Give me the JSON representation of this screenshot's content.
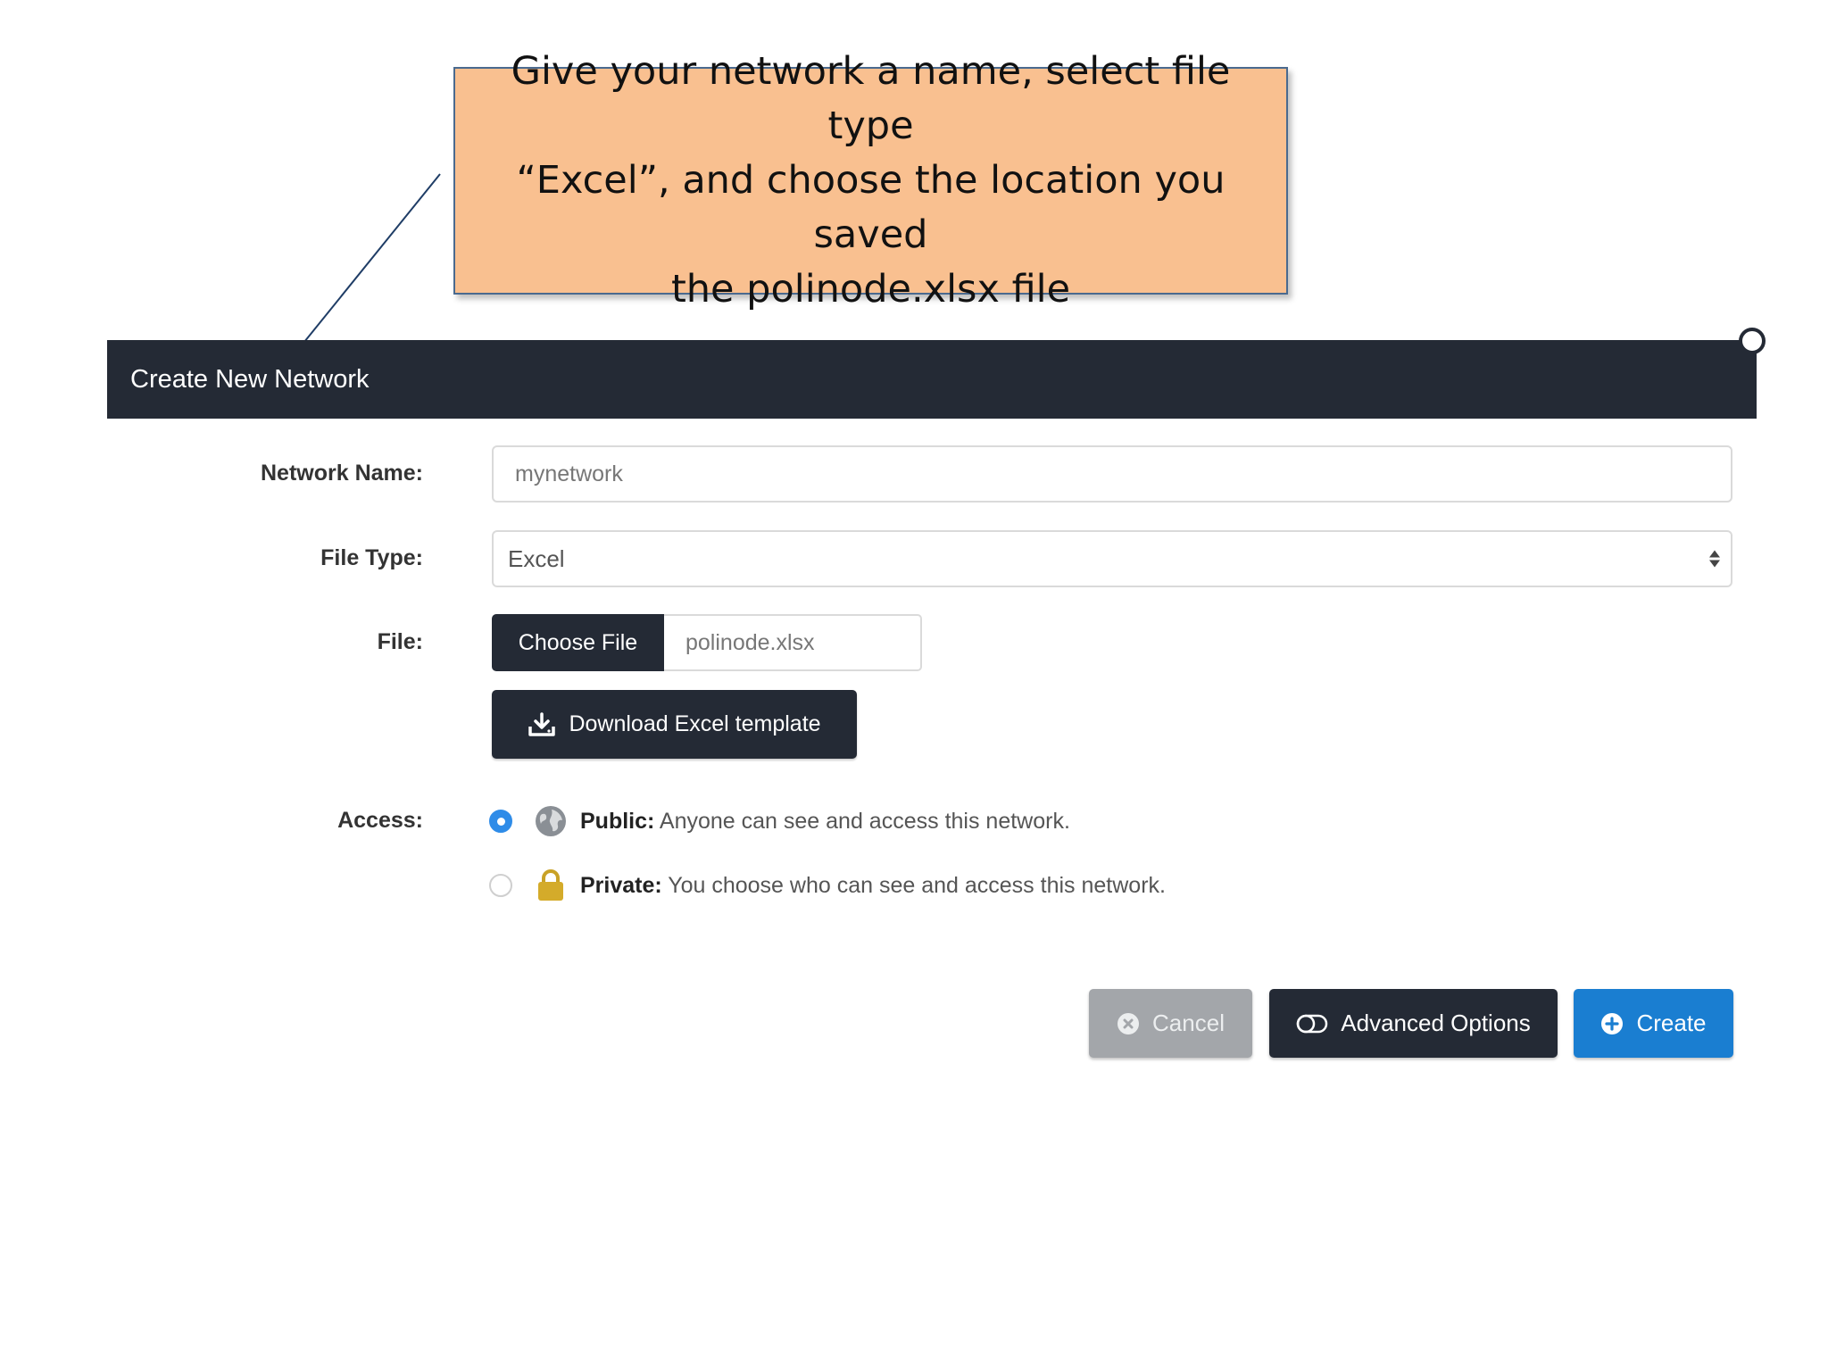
{
  "callout": {
    "text": "Give your network a name, select file type\n“Excel”, and choose the location you saved\nthe polinode.xlsx file",
    "background": "#f9c090"
  },
  "dialog": {
    "title": "Create New Network",
    "header_color": "#242a35"
  },
  "form": {
    "network_name_label": "Network Name:",
    "network_name_value": "mynetwork",
    "file_type_label": "File Type:",
    "file_type_value": "Excel",
    "file_label": "File:",
    "choose_file_label": "Choose File",
    "file_name": "polinode.xlsx",
    "download_template_label": "Download Excel template",
    "access_label": "Access:",
    "access_options": [
      {
        "title": "Public:",
        "description": " Anyone can see and access this network.",
        "icon": "globe-icon",
        "selected": true
      },
      {
        "title": "Private:",
        "description": " You choose who can see and access this network.",
        "icon": "lock-icon",
        "selected": false
      }
    ]
  },
  "buttons": {
    "cancel_label": "Cancel",
    "advanced_label": "Advanced Options",
    "create_label": "Create",
    "create_color": "#1a7ed1",
    "cancel_color": "#a3a6aa"
  }
}
